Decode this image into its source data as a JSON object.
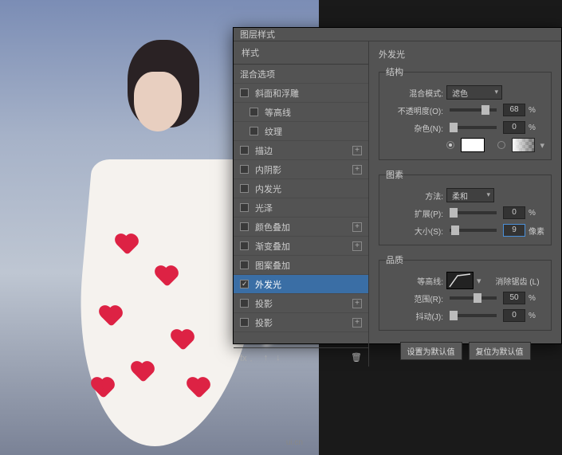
{
  "watermark": "ui.cn",
  "dialog": {
    "title": "图层样式",
    "left": {
      "header": "样式",
      "blending": "混合选项",
      "items": [
        {
          "label": "斜面和浮雕",
          "checked": false,
          "plus": false
        },
        {
          "label": "等高线",
          "checked": false,
          "plus": false,
          "indent": true
        },
        {
          "label": "纹理",
          "checked": false,
          "plus": false,
          "indent": true
        },
        {
          "label": "描边",
          "checked": false,
          "plus": true
        },
        {
          "label": "内阴影",
          "checked": false,
          "plus": true
        },
        {
          "label": "内发光",
          "checked": false,
          "plus": false
        },
        {
          "label": "光泽",
          "checked": false,
          "plus": false
        },
        {
          "label": "颜色叠加",
          "checked": false,
          "plus": true
        },
        {
          "label": "渐变叠加",
          "checked": false,
          "plus": true
        },
        {
          "label": "图案叠加",
          "checked": false,
          "plus": false
        },
        {
          "label": "外发光",
          "checked": true,
          "plus": false,
          "selected": true
        },
        {
          "label": "投影",
          "checked": false,
          "plus": true
        },
        {
          "label": "投影",
          "checked": false,
          "plus": true
        }
      ]
    },
    "right": {
      "title": "外发光",
      "structure": {
        "legend": "结构",
        "blend_mode_label": "混合模式:",
        "blend_mode_value": "滤色",
        "opacity_label": "不透明度(O):",
        "opacity_value": "68",
        "noise_label": "杂色(N):",
        "noise_value": "0"
      },
      "elements": {
        "legend": "图素",
        "method_label": "方法:",
        "method_value": "柔和",
        "spread_label": "扩展(P):",
        "spread_value": "0",
        "size_label": "大小(S):",
        "size_value": "9",
        "size_unit": "像素"
      },
      "quality": {
        "legend": "品质",
        "contour_label": "等高线:",
        "antialias_label": "消除锯齿 (L)",
        "range_label": "范围(R):",
        "range_value": "50",
        "jitter_label": "抖动(J):",
        "jitter_value": "0"
      },
      "buttons": {
        "make_default": "设置为默认值",
        "reset_default": "复位为默认值"
      },
      "pct": "%"
    }
  }
}
